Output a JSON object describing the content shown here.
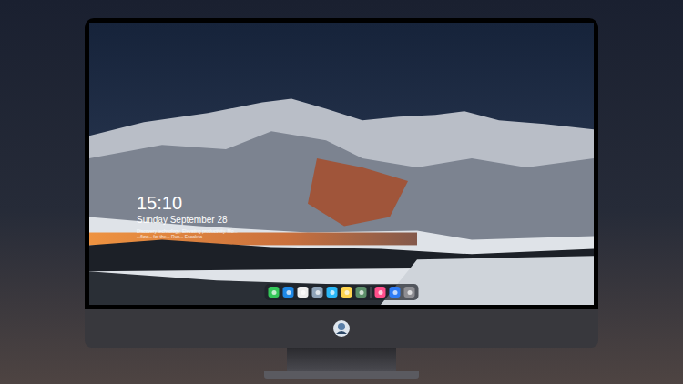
{
  "lock_screen": {
    "time": "15:10",
    "date": "Sunday September 28",
    "caption": [
      "Discovery technology, Elevating productivity. Mo...",
      "...flow... for the... Run... Escaleta"
    ]
  },
  "dock": {
    "groups": [
      [
        {
          "color": "#34c759"
        },
        {
          "color": "#1e88e5"
        },
        {
          "color": "#eeeeee"
        },
        {
          "color": "#8fa3b8"
        },
        {
          "color": "#29b6f6"
        },
        {
          "color": "#ffd54f"
        },
        {
          "color": "#5c8f6a"
        }
      ],
      [
        {
          "color": "#ff4f8b"
        },
        {
          "color": "#2f7cf6"
        },
        {
          "color": "#8e8e93"
        }
      ]
    ]
  }
}
